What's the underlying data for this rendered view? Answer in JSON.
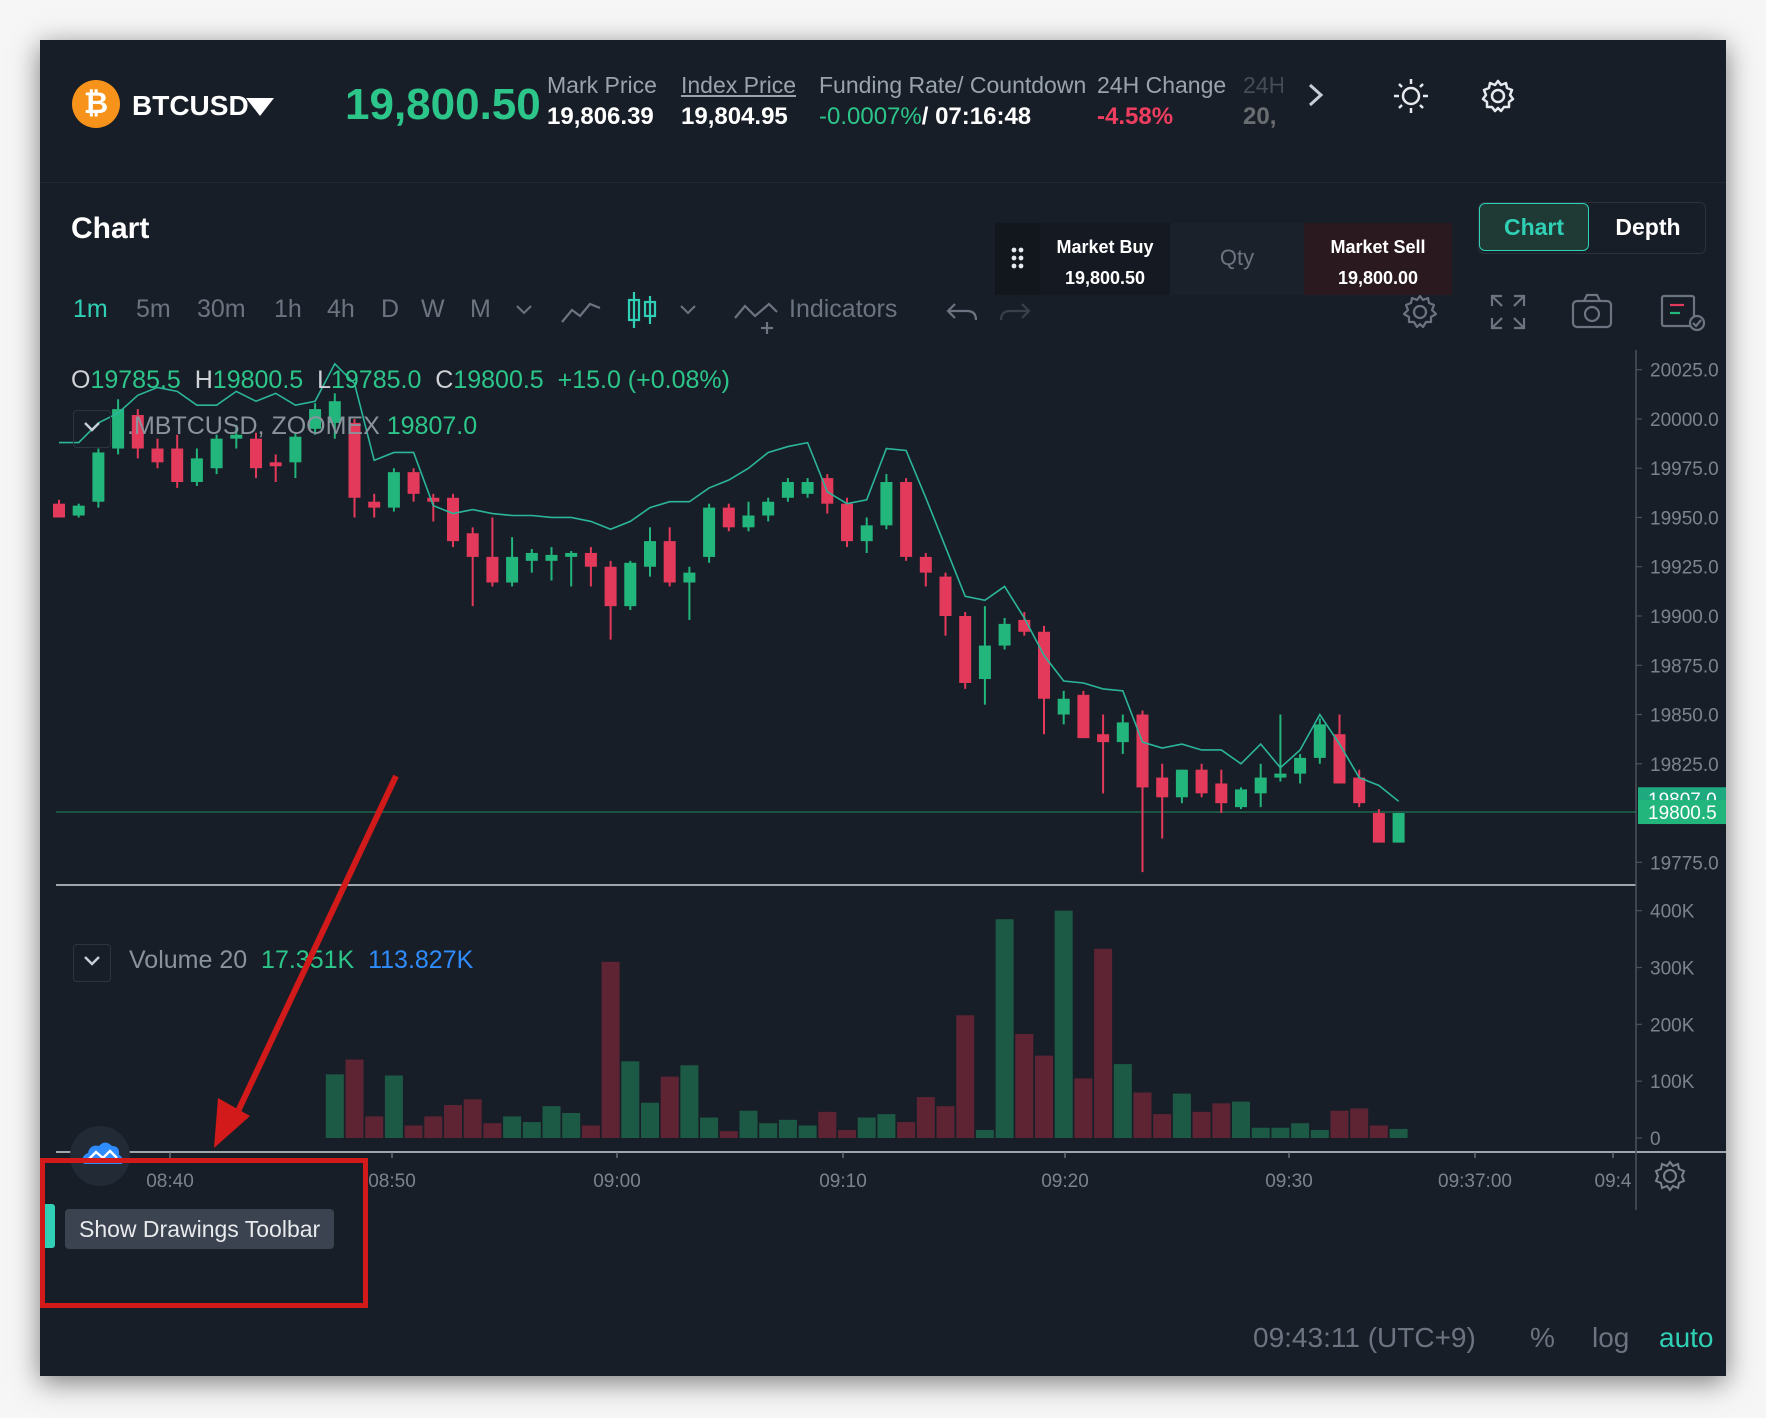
{
  "header": {
    "symbol_icon": "₿",
    "symbol": "BTCUSD",
    "last_price": "19,800.50",
    "stats": [
      {
        "label": "Mark Price",
        "value": "19,806.39"
      },
      {
        "label": "Index Price",
        "value": "19,804.95"
      },
      {
        "label": "Funding Rate/ Countdown",
        "value_rate": "-0.0007%",
        "value_countdown": "/ 07:16:48"
      },
      {
        "label": "24H Change",
        "value": "-4.58%"
      },
      {
        "label": "24H",
        "value": "20,"
      }
    ]
  },
  "card": {
    "title": "Chart",
    "view_tabs": [
      "Chart",
      "Depth"
    ],
    "active_tab": "Chart"
  },
  "quick_trade": {
    "buy_label": "Market Buy",
    "buy_price": "19,800.50",
    "qty_placeholder": "Qty",
    "sell_label": "Market Sell",
    "sell_price": "19,800.00"
  },
  "toolbar": {
    "timeframes": [
      "1m",
      "5m",
      "30m",
      "1h",
      "4h",
      "D",
      "W",
      "M"
    ],
    "active_timeframe": "1m",
    "indicators_label": "Indicators"
  },
  "ohlc": {
    "o_label": "O",
    "o": "19785.5",
    "h_label": "H",
    "h": "19800.5",
    "l_label": "L",
    "l": "19785.0",
    "c_label": "C",
    "c": "19800.5",
    "change": "+15.0 (+0.08%)"
  },
  "index_overlay": {
    "name": ".MBTCUSD, ZOOMEX",
    "value": "19807.0"
  },
  "volume_legend": {
    "name": "Volume 20",
    "value1": "17.351K",
    "value2": "113.827K"
  },
  "tooltip": {
    "text": "Show Drawings Toolbar"
  },
  "bottom_bar": {
    "time": "09:43:11 (UTC+9)",
    "percent": "%",
    "log": "log",
    "auto": "auto"
  },
  "colors": {
    "up": "#23b67c",
    "down": "#e3395a",
    "accent": "#2fd0b5",
    "index_line": "#2bb59a",
    "volume_blue": "#2f8cff"
  },
  "chart_data": {
    "type": "candlestick",
    "price_axis_ticks": [
      "20025.0",
      "20000.0",
      "19975.0",
      "19950.0",
      "19925.0",
      "19900.0",
      "19875.0",
      "19850.0",
      "19825.0",
      "19775.0"
    ],
    "price_ylim": [
      19765,
      20035
    ],
    "price_labels": {
      "index": "19807.0",
      "last": "19800.5"
    },
    "volume_axis_ticks": [
      "400K",
      "300K",
      "200K",
      "100K",
      "0"
    ],
    "volume_ylim": [
      0,
      410000
    ],
    "time_ticks": [
      "08:40",
      "08:50",
      "09:00",
      "09:10",
      "09:20",
      "09:30",
      "09:37:00",
      "09:4"
    ],
    "candles": [
      {
        "o": 19957,
        "h": 19959,
        "l": 19951,
        "c": 19950
      },
      {
        "o": 19951,
        "h": 19957,
        "l": 19950,
        "c": 19956
      },
      {
        "o": 19958,
        "h": 19985,
        "l": 19955,
        "c": 19983
      },
      {
        "o": 19985,
        "h": 20010,
        "l": 19982,
        "c": 20005
      },
      {
        "o": 20002,
        "h": 20005,
        "l": 19980,
        "c": 19985
      },
      {
        "o": 19985,
        "h": 19990,
        "l": 19975,
        "c": 19978
      },
      {
        "o": 19985,
        "h": 19992,
        "l": 19965,
        "c": 19968
      },
      {
        "o": 19968,
        "h": 19985,
        "l": 19966,
        "c": 19980
      },
      {
        "o": 19975,
        "h": 19992,
        "l": 19972,
        "c": 19990
      },
      {
        "o": 19990,
        "h": 19997,
        "l": 19985,
        "c": 19992
      },
      {
        "o": 19990,
        "h": 19993,
        "l": 19970,
        "c": 19975
      },
      {
        "o": 19978,
        "h": 19982,
        "l": 19968,
        "c": 19976
      },
      {
        "o": 19978,
        "h": 19993,
        "l": 19970,
        "c": 19991
      },
      {
        "o": 19995,
        "h": 20008,
        "l": 19992,
        "c": 20005
      },
      {
        "o": 19998,
        "h": 20013,
        "l": 19990,
        "c": 20009
      },
      {
        "o": 19998,
        "h": 20000,
        "l": 19950,
        "c": 19960
      },
      {
        "o": 19958,
        "h": 19962,
        "l": 19950,
        "c": 19955
      },
      {
        "o": 19955,
        "h": 19975,
        "l": 19953,
        "c": 19973
      },
      {
        "o": 19973,
        "h": 19975,
        "l": 19958,
        "c": 19962
      },
      {
        "o": 19960,
        "h": 19962,
        "l": 19948,
        "c": 19958
      },
      {
        "o": 19960,
        "h": 19962,
        "l": 19935,
        "c": 19938
      },
      {
        "o": 19942,
        "h": 19945,
        "l": 19905,
        "c": 19930
      },
      {
        "o": 19930,
        "h": 19950,
        "l": 19915,
        "c": 19917
      },
      {
        "o": 19917,
        "h": 19940,
        "l": 19915,
        "c": 19930
      },
      {
        "o": 19928,
        "h": 19934,
        "l": 19922,
        "c": 19932
      },
      {
        "o": 19928,
        "h": 19935,
        "l": 19918,
        "c": 19931
      },
      {
        "o": 19930,
        "h": 19933,
        "l": 19915,
        "c": 19932
      },
      {
        "o": 19932,
        "h": 19935,
        "l": 19915,
        "c": 19925
      },
      {
        "o": 19925,
        "h": 19928,
        "l": 19888,
        "c": 19905
      },
      {
        "o": 19905,
        "h": 19928,
        "l": 19903,
        "c": 19927
      },
      {
        "o": 19925,
        "h": 19945,
        "l": 19920,
        "c": 19938
      },
      {
        "o": 19938,
        "h": 19945,
        "l": 19915,
        "c": 19917
      },
      {
        "o": 19917,
        "h": 19925,
        "l": 19898,
        "c": 19922
      },
      {
        "o": 19930,
        "h": 19957,
        "l": 19927,
        "c": 19955
      },
      {
        "o": 19955,
        "h": 19957,
        "l": 19943,
        "c": 19945
      },
      {
        "o": 19945,
        "h": 19958,
        "l": 19943,
        "c": 19951
      },
      {
        "o": 19951,
        "h": 19960,
        "l": 19948,
        "c": 19958
      },
      {
        "o": 19960,
        "h": 19970,
        "l": 19958,
        "c": 19968
      },
      {
        "o": 19962,
        "h": 19970,
        "l": 19960,
        "c": 19968
      },
      {
        "o": 19970,
        "h": 19972,
        "l": 19952,
        "c": 19957
      },
      {
        "o": 19957,
        "h": 19960,
        "l": 19935,
        "c": 19938
      },
      {
        "o": 19938,
        "h": 19950,
        "l": 19932,
        "c": 19946
      },
      {
        "o": 19946,
        "h": 19972,
        "l": 19944,
        "c": 19968
      },
      {
        "o": 19968,
        "h": 19970,
        "l": 19928,
        "c": 19930
      },
      {
        "o": 19930,
        "h": 19932,
        "l": 19915,
        "c": 19922
      },
      {
        "o": 19920,
        "h": 19922,
        "l": 19890,
        "c": 19900
      },
      {
        "o": 19900,
        "h": 19902,
        "l": 19863,
        "c": 19866
      },
      {
        "o": 19868,
        "h": 19905,
        "l": 19855,
        "c": 19885
      },
      {
        "o": 19885,
        "h": 19899,
        "l": 19883,
        "c": 19896
      },
      {
        "o": 19898,
        "h": 19902,
        "l": 19890,
        "c": 19892
      },
      {
        "o": 19892,
        "h": 19895,
        "l": 19840,
        "c": 19858
      },
      {
        "o": 19850,
        "h": 19862,
        "l": 19845,
        "c": 19858
      },
      {
        "o": 19860,
        "h": 19862,
        "l": 19840,
        "c": 19838
      },
      {
        "o": 19840,
        "h": 19850,
        "l": 19810,
        "c": 19836
      },
      {
        "o": 19836,
        "h": 19850,
        "l": 19830,
        "c": 19846
      },
      {
        "o": 19850,
        "h": 19852,
        "l": 19770,
        "c": 19813
      },
      {
        "o": 19818,
        "h": 19825,
        "l": 19787,
        "c": 19808
      },
      {
        "o": 19808,
        "h": 19822,
        "l": 19805,
        "c": 19822
      },
      {
        "o": 19822,
        "h": 19825,
        "l": 19808,
        "c": 19810
      },
      {
        "o": 19815,
        "h": 19822,
        "l": 19800,
        "c": 19805
      },
      {
        "o": 19803,
        "h": 19813,
        "l": 19802,
        "c": 19812
      },
      {
        "o": 19810,
        "h": 19825,
        "l": 19803,
        "c": 19818
      },
      {
        "o": 19818,
        "h": 19850,
        "l": 19816,
        "c": 19820
      },
      {
        "o": 19820,
        "h": 19830,
        "l": 19815,
        "c": 19828
      },
      {
        "o": 19828,
        "h": 19848,
        "l": 19825,
        "c": 19845
      },
      {
        "o": 19840,
        "h": 19850,
        "l": 19815,
        "c": 19815
      },
      {
        "o": 19818,
        "h": 19822,
        "l": 19803,
        "c": 19805
      },
      {
        "o": 19800,
        "h": 19802,
        "l": 19785,
        "c": 19785
      },
      {
        "o": 19785,
        "h": 19800,
        "l": 19785,
        "c": 19800
      }
    ],
    "index_line": [
      19988,
      19988,
      19998,
      20003,
      20012,
      20016,
      20014,
      20007,
      20007,
      20014,
      20009,
      20013,
      20007,
      20009,
      20028,
      20018,
      19979,
      19983,
      19983,
      19956,
      19952,
      19954,
      19952,
      19951,
      19951,
      19950,
      19950,
      19948,
      19944,
      19948,
      19955,
      19958,
      19958,
      19965,
      19969,
      19975,
      19983,
      19986,
      19988,
      19963,
      19957,
      19959,
      19985,
      19984,
      19960,
      19935,
      19910,
      19908,
      19915,
      19899,
      19880,
      19867,
      19866,
      19863,
      19862,
      19836,
      19833,
      19835,
      19832,
      19832,
      19825,
      19835,
      19823,
      19832,
      19850,
      19835,
      19818,
      19814,
      19806
    ],
    "volume": [
      0,
      0,
      0,
      0,
      0,
      0,
      0,
      0,
      0,
      0,
      0,
      0,
      0,
      0,
      112000,
      138000,
      38000,
      110000,
      22000,
      38000,
      58000,
      68000,
      26000,
      38000,
      28000,
      56000,
      44000,
      22000,
      310000,
      135000,
      62000,
      108000,
      128000,
      36000,
      12000,
      48000,
      26000,
      32000,
      22000,
      46000,
      14000,
      36000,
      42000,
      28000,
      72000,
      56000,
      216000,
      14000,
      385000,
      183000,
      145000,
      400000,
      105000,
      333000,
      130000,
      80000,
      42000,
      78000,
      46000,
      61000,
      64000,
      18000,
      18000,
      26000,
      14000,
      48000,
      52000,
      22000,
      16000
    ]
  }
}
